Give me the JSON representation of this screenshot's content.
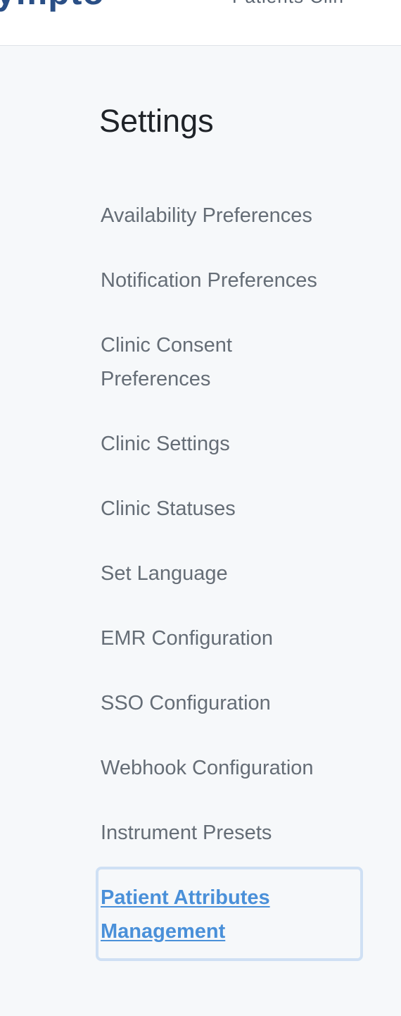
{
  "header": {
    "logo_text": "ympto",
    "nav_fragment": "Patients   Clin"
  },
  "page": {
    "title": "Settings"
  },
  "settings_nav": {
    "items": [
      {
        "label": "Availability Preferences",
        "active": false
      },
      {
        "label": "Notification Preferences",
        "active": false
      },
      {
        "label": "Clinic Consent Preferences",
        "active": false
      },
      {
        "label": "Clinic Settings",
        "active": false
      },
      {
        "label": "Clinic Statuses",
        "active": false
      },
      {
        "label": "Set Language",
        "active": false
      },
      {
        "label": "EMR Configuration",
        "active": false
      },
      {
        "label": "SSO Configuration",
        "active": false
      },
      {
        "label": "Webhook Configuration",
        "active": false
      },
      {
        "label": "Instrument Presets",
        "active": false
      },
      {
        "label": "Patient Attributes Management",
        "active": true
      }
    ]
  },
  "colors": {
    "brand": "#2a4f86",
    "active_link": "#4a90d9",
    "inactive_link": "#656d76",
    "focus_ring": "#cfe0f4",
    "background": "#f6f8fa"
  }
}
